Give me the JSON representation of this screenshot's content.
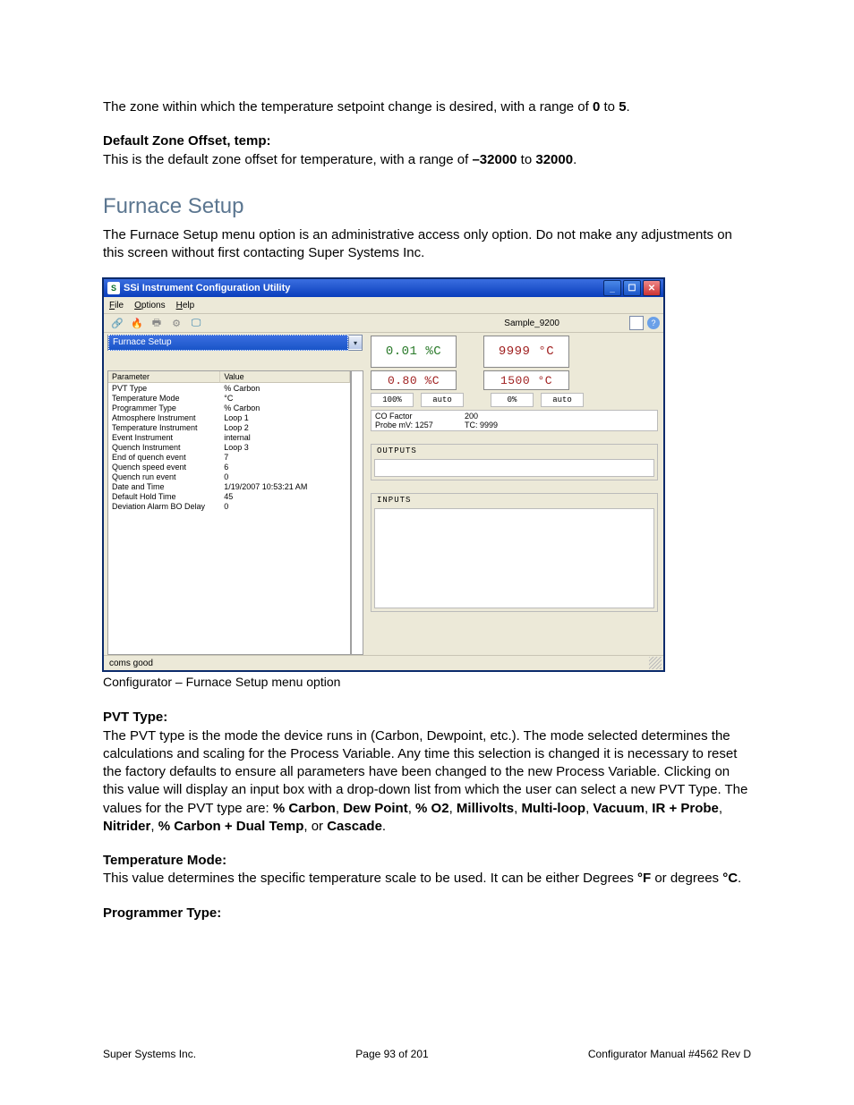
{
  "doc": {
    "p1": "The zone within which the temperature setpoint change is desired, with a range of ",
    "p1_b1": "0",
    "p1_mid": " to ",
    "p1_b2": "5",
    "p1_end": ".",
    "h1": "Default Zone Offset, temp:",
    "p2a": "This is the default zone offset for temperature, with a range of ",
    "p2b": "–32000",
    "p2c": " to ",
    "p2d": "32000",
    "p2e": ".",
    "section": "Furnace Setup",
    "p3": "The Furnace Setup menu option is an administrative access only option. Do not make any adjustments on this screen without first contacting Super Systems Inc.",
    "caption": "Configurator – Furnace Setup menu option",
    "h2": "PVT Type:",
    "p4a": "The PVT type is the mode the device runs in (Carbon, Dewpoint, etc.). The mode selected determines the calculations and scaling for the Process Variable. Any time this selection is changed it is necessary to reset the factory defaults to ensure all parameters have been changed to the new Process Variable.  Clicking on this value will display an input box with a drop-down list from which the user can select a new PVT Type.  The values for the PVT type are: ",
    "p4b": "% Carbon",
    "p4c": ", ",
    "p4d": "Dew Point",
    "p4e": ", ",
    "p4f": "% O2",
    "p4g": ", ",
    "p4h": "Millivolts",
    "p4i": ", ",
    "p4j": "Multi-loop",
    "p4k": ", ",
    "p4l": "Vacuum",
    "p4m": ", ",
    "p4n": "IR + Probe",
    "p4o": ", ",
    "p4p": "Nitrider",
    "p4q": ", ",
    "p4r": "% Carbon + Dual Temp",
    "p4s": ", or ",
    "p4t": "Cascade",
    "p4u": ".",
    "h3": "Temperature Mode:",
    "p5a": "This value determines the specific temperature scale to be used.  It can be either Degrees ",
    "p5b": "°F",
    "p5c": " or degrees ",
    "p5d": "°C",
    "p5e": ".",
    "h4": "Programmer Type:"
  },
  "footer": {
    "left": "Super Systems Inc.",
    "center": "Page 93 of 201",
    "right": "Configurator Manual #4562 Rev D"
  },
  "win": {
    "title": "SSi Instrument Configuration Utility",
    "menu": {
      "file": "File",
      "options": "Options",
      "help": "Help"
    },
    "profile": "Sample_9200",
    "combo": "Furnace Setup",
    "grid": {
      "headers": {
        "param": "Parameter",
        "value": "Value"
      },
      "rows": [
        {
          "p": "PVT Type",
          "v": "% Carbon"
        },
        {
          "p": "Temperature Mode",
          "v": "°C"
        },
        {
          "p": "Programmer Type",
          "v": "% Carbon"
        },
        {
          "p": "Atmosphere Instrument",
          "v": "Loop 1"
        },
        {
          "p": "Temperature Instrument",
          "v": "Loop 2"
        },
        {
          "p": "Event Instrument",
          "v": "internal"
        },
        {
          "p": "Quench Instrument",
          "v": "Loop 3"
        },
        {
          "p": "End of quench event",
          "v": "7"
        },
        {
          "p": "Quench speed event",
          "v": "6"
        },
        {
          "p": "Quench run event",
          "v": "0"
        },
        {
          "p": "Date and Time",
          "v": "1/19/2007 10:53:21 AM"
        },
        {
          "p": "Default Hold Time",
          "v": "45"
        },
        {
          "p": "Deviation Alarm BO Delay",
          "v": "0"
        }
      ]
    },
    "readouts": {
      "pv_c": "0.01 %C",
      "pv_t": "9999 °C",
      "sp_c": "0.80 %C",
      "sp_t": "1500 °C",
      "out_c_pct": "100%",
      "out_c_mode": "auto",
      "out_t_pct": "0%",
      "out_t_mode": "auto",
      "co_factor_label": "CO Factor",
      "co_factor_val": "200",
      "probe_label": "Probe mV: 1257",
      "tc_label": "TC: 9999"
    },
    "panels": {
      "outputs": "OUTPUTS",
      "inputs": "INPUTS"
    },
    "status": "coms good"
  }
}
